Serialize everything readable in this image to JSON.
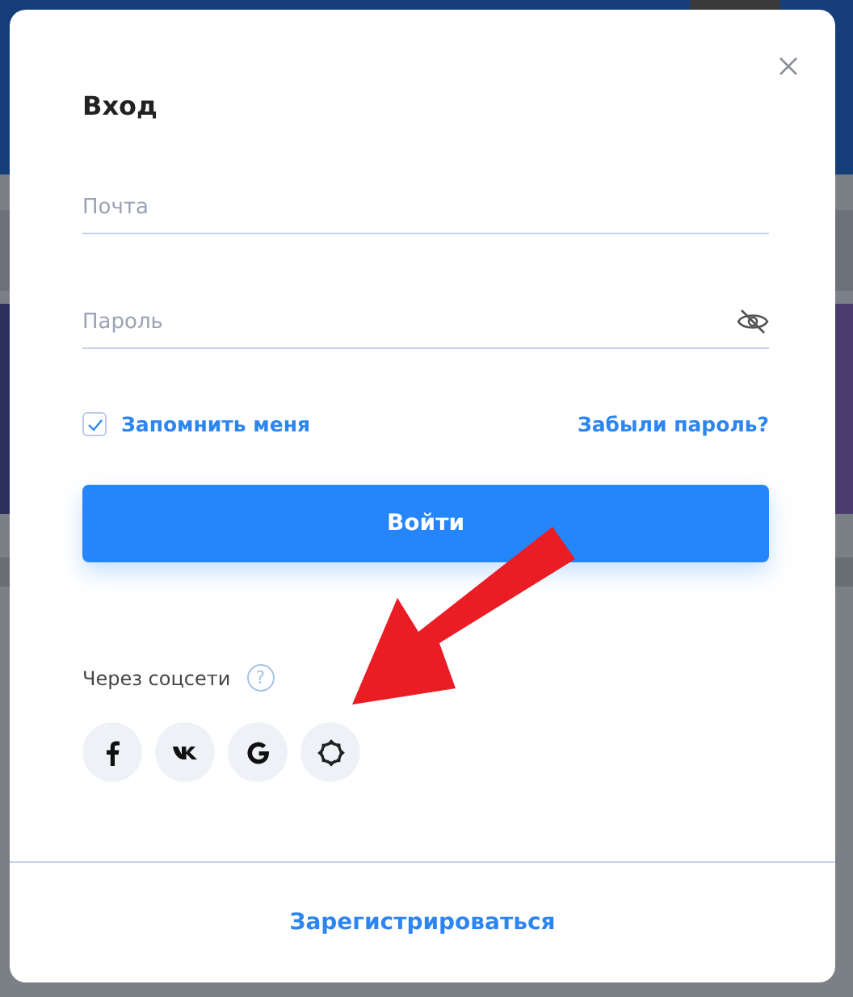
{
  "dialog": {
    "title": "Вход"
  },
  "fields": [
    {
      "kind": "email",
      "placeholder": "Почта"
    },
    {
      "kind": "password",
      "placeholder": "Пароль"
    }
  ],
  "remember": {
    "label": "Запомнить меня",
    "checked": true
  },
  "forgot_link": "Забыли пароль?",
  "submit_button": "Войти",
  "social": {
    "label": "Через соцсети",
    "help": "?",
    "buttons": [
      {
        "kind": "facebook"
      },
      {
        "kind": "vk"
      },
      {
        "kind": "google"
      },
      {
        "kind": "other"
      }
    ]
  },
  "register_link": "Зарегистрироваться"
}
